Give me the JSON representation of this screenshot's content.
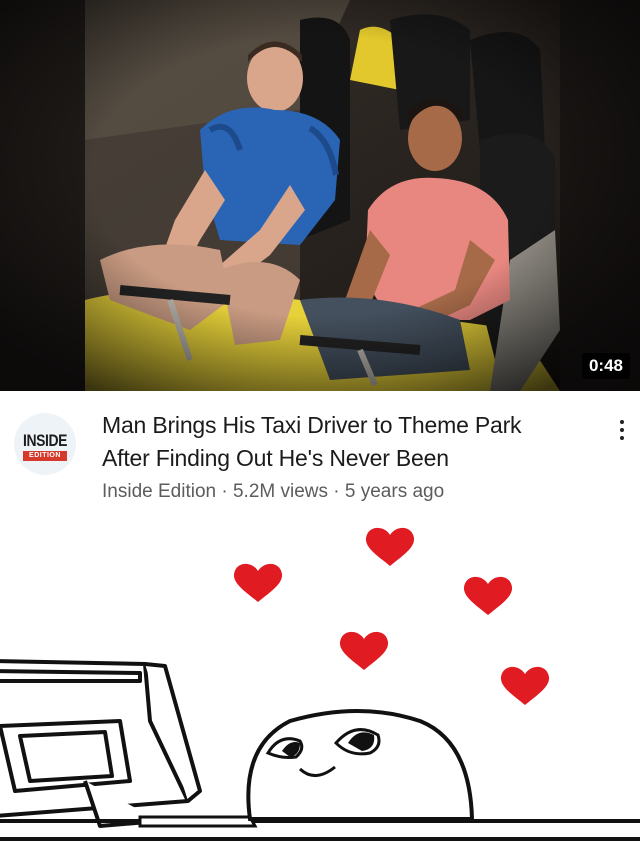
{
  "thumbnail": {
    "duration": "0:48",
    "description_icon": "roller-coaster-photo"
  },
  "channel": {
    "avatar_line1": "INSIDE",
    "avatar_line2": "EDITION"
  },
  "video": {
    "title_line1": "Man Brings His Taxi Driver to Theme Park",
    "title_line2": "After Finding Out He's Never Been",
    "channel_name": "Inside Edition",
    "separator": "·",
    "views": "5.2M views",
    "age": "5 years ago"
  },
  "menu": {
    "icon": "more-vertical-icon"
  },
  "meme": {
    "icon": "heart-eyes-computer-guy",
    "heart_color": "#e11b22"
  }
}
